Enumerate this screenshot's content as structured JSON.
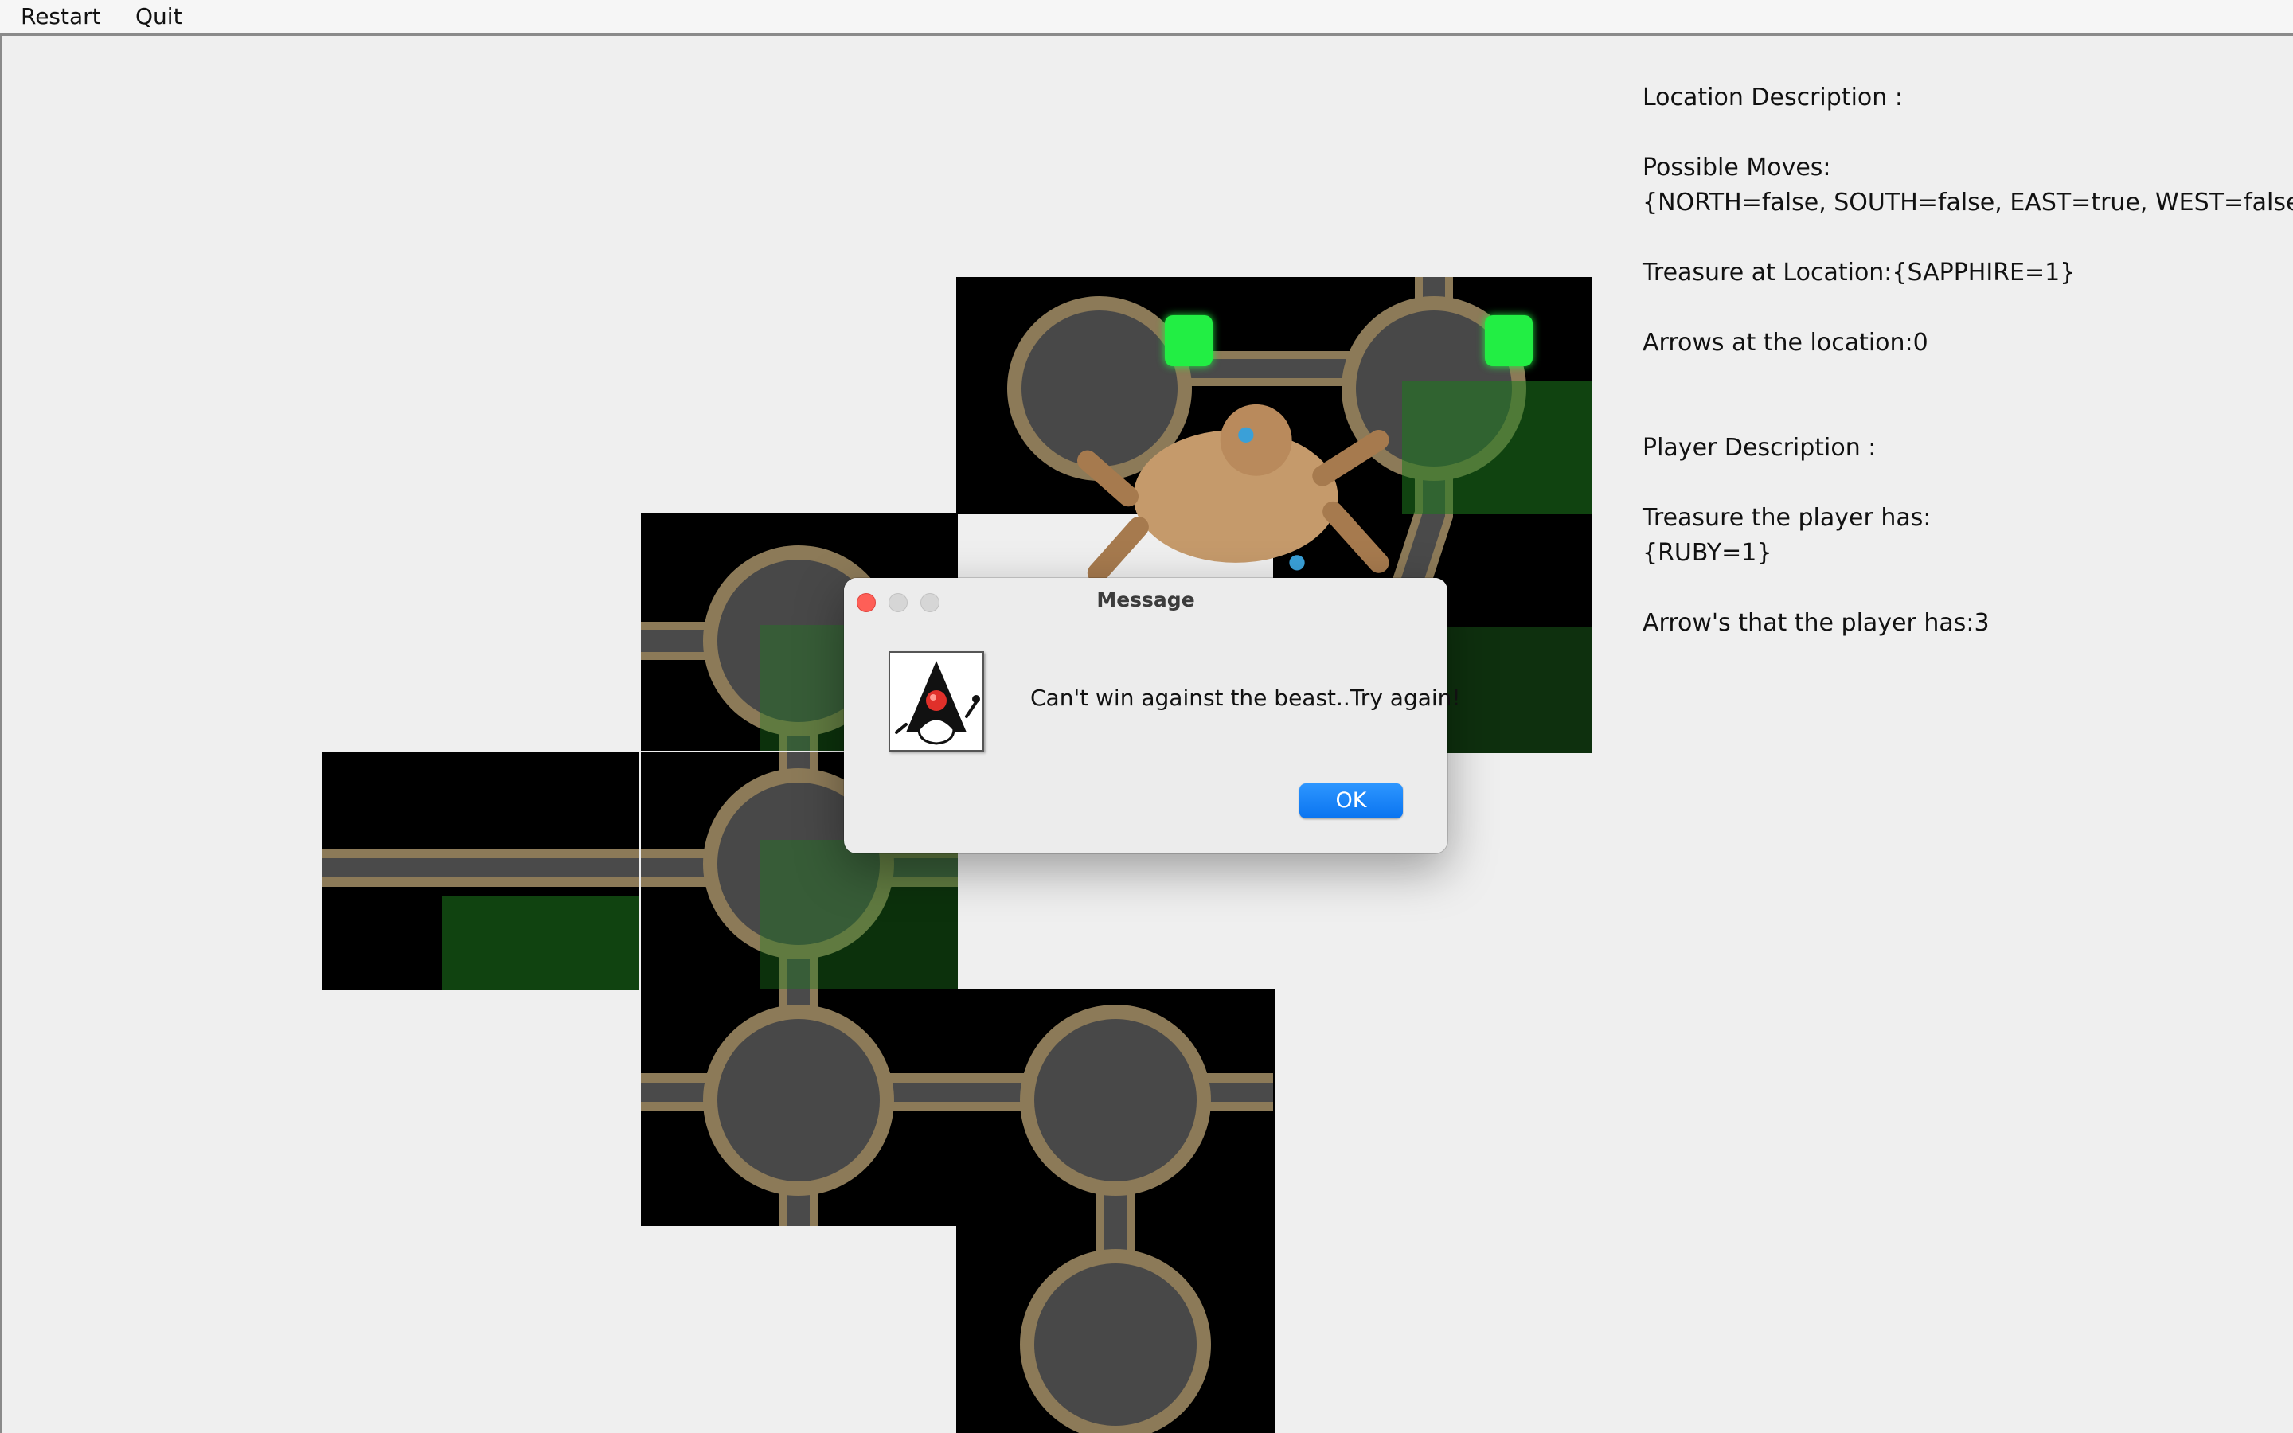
{
  "menu": {
    "restart": "Restart",
    "quit": "Quit"
  },
  "info": {
    "location_header": "Location Description :",
    "moves_label": "Possible Moves:",
    "moves_value": "{NORTH=false, SOUTH=false, EAST=true, WEST=false}",
    "treasure_location": "Treasure at Location:{SAPPHIRE=1}",
    "arrows_location": "Arrows at the location:0",
    "player_header": "Player Description :",
    "treasure_player_label": "Treasure the player has:",
    "treasure_player_value": "{RUBY=1}",
    "arrows_player": "Arrow's that the player has:3"
  },
  "dialog": {
    "title": "Message",
    "message": "Can't win against the beast..Try again!",
    "ok": "OK"
  },
  "colors": {
    "background": "#efefef",
    "tile_background": "#000000",
    "path_border": "#8c7a58",
    "path_floor": "#4a4a4a",
    "pit_slime": "#1f7a1f",
    "marker": "#22ee44",
    "ok_button": "#0a74f0"
  },
  "icons": {
    "beast": "monster-icon",
    "player_marker": "green-square-marker",
    "dialog_icon": "java-duke-icon"
  }
}
